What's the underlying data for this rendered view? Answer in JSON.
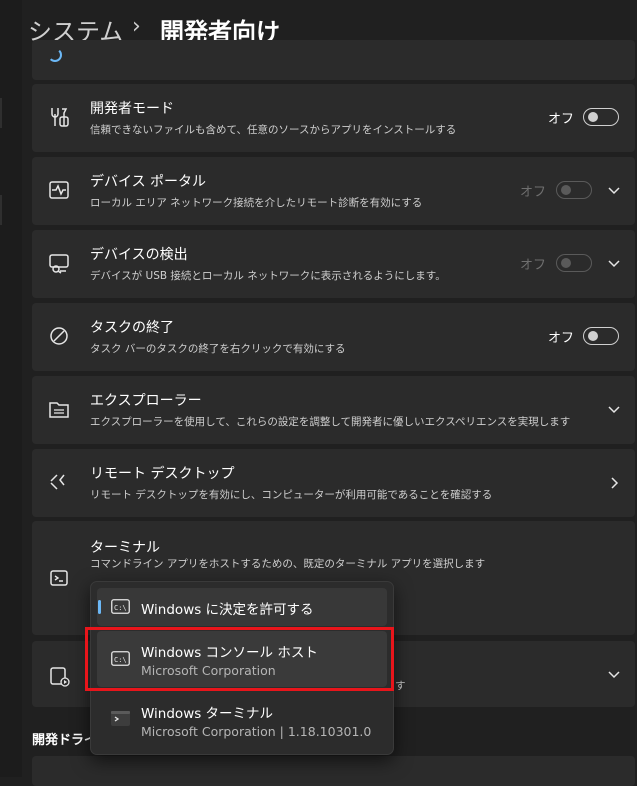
{
  "breadcrumb": {
    "parent": "システム",
    "separator": "›",
    "current": "開発者向け"
  },
  "settings": [
    {
      "title": "開発者モード",
      "desc": "信頼できないファイルも含めて、任意のソースからアプリをインストールする",
      "state": "オフ",
      "icon": "developer-tools-icon"
    },
    {
      "title": "デバイス ポータル",
      "desc": "ローカル エリア ネットワーク接続を介したリモート診断を有効にする",
      "state": "オフ",
      "icon": "device-portal-icon"
    },
    {
      "title": "デバイスの検出",
      "desc": "デバイスが USB 接続とローカル ネットワークに表示されるようにします。",
      "state": "オフ",
      "icon": "device-discovery-icon"
    },
    {
      "title": "タスクの終了",
      "desc": "タスク バーのタスクの終了を右クリックで有効にする",
      "state": "オフ",
      "icon": "end-task-icon"
    },
    {
      "title": "エクスプローラー",
      "desc": "エクスプローラーを使用して、これらの設定を調整して開発者に優しいエクスペリエンスを実現します",
      "icon": "folder-icon"
    },
    {
      "title": "リモート デスクトップ",
      "desc": "リモート デスクトップを有効にし、コンピューターが利用可能であることを確認する",
      "icon": "remote-desktop-icon"
    },
    {
      "title": "ターミナル",
      "desc": "コマンドライン アプリをホストするための、既定のターミナル アプリを選択します",
      "icon": "terminal-icon"
    }
  ],
  "card7": {
    "desc_fragment": "す"
  },
  "section": {
    "label": "開発ドライブ"
  },
  "terminal_dropdown": {
    "options": [
      {
        "title": "Windows に決定を許可する",
        "selected": true
      },
      {
        "title": "Windows コンソール ホスト",
        "subtitle": "Microsoft Corporation"
      },
      {
        "title": "Windows ターミナル",
        "subtitle": "Microsoft Corporation | 1.18.10301.0"
      }
    ]
  },
  "colors": {
    "background": "#202020",
    "card": "#2b2b2b",
    "accent": "#6cb8f6",
    "highlight": "#e8151b"
  }
}
